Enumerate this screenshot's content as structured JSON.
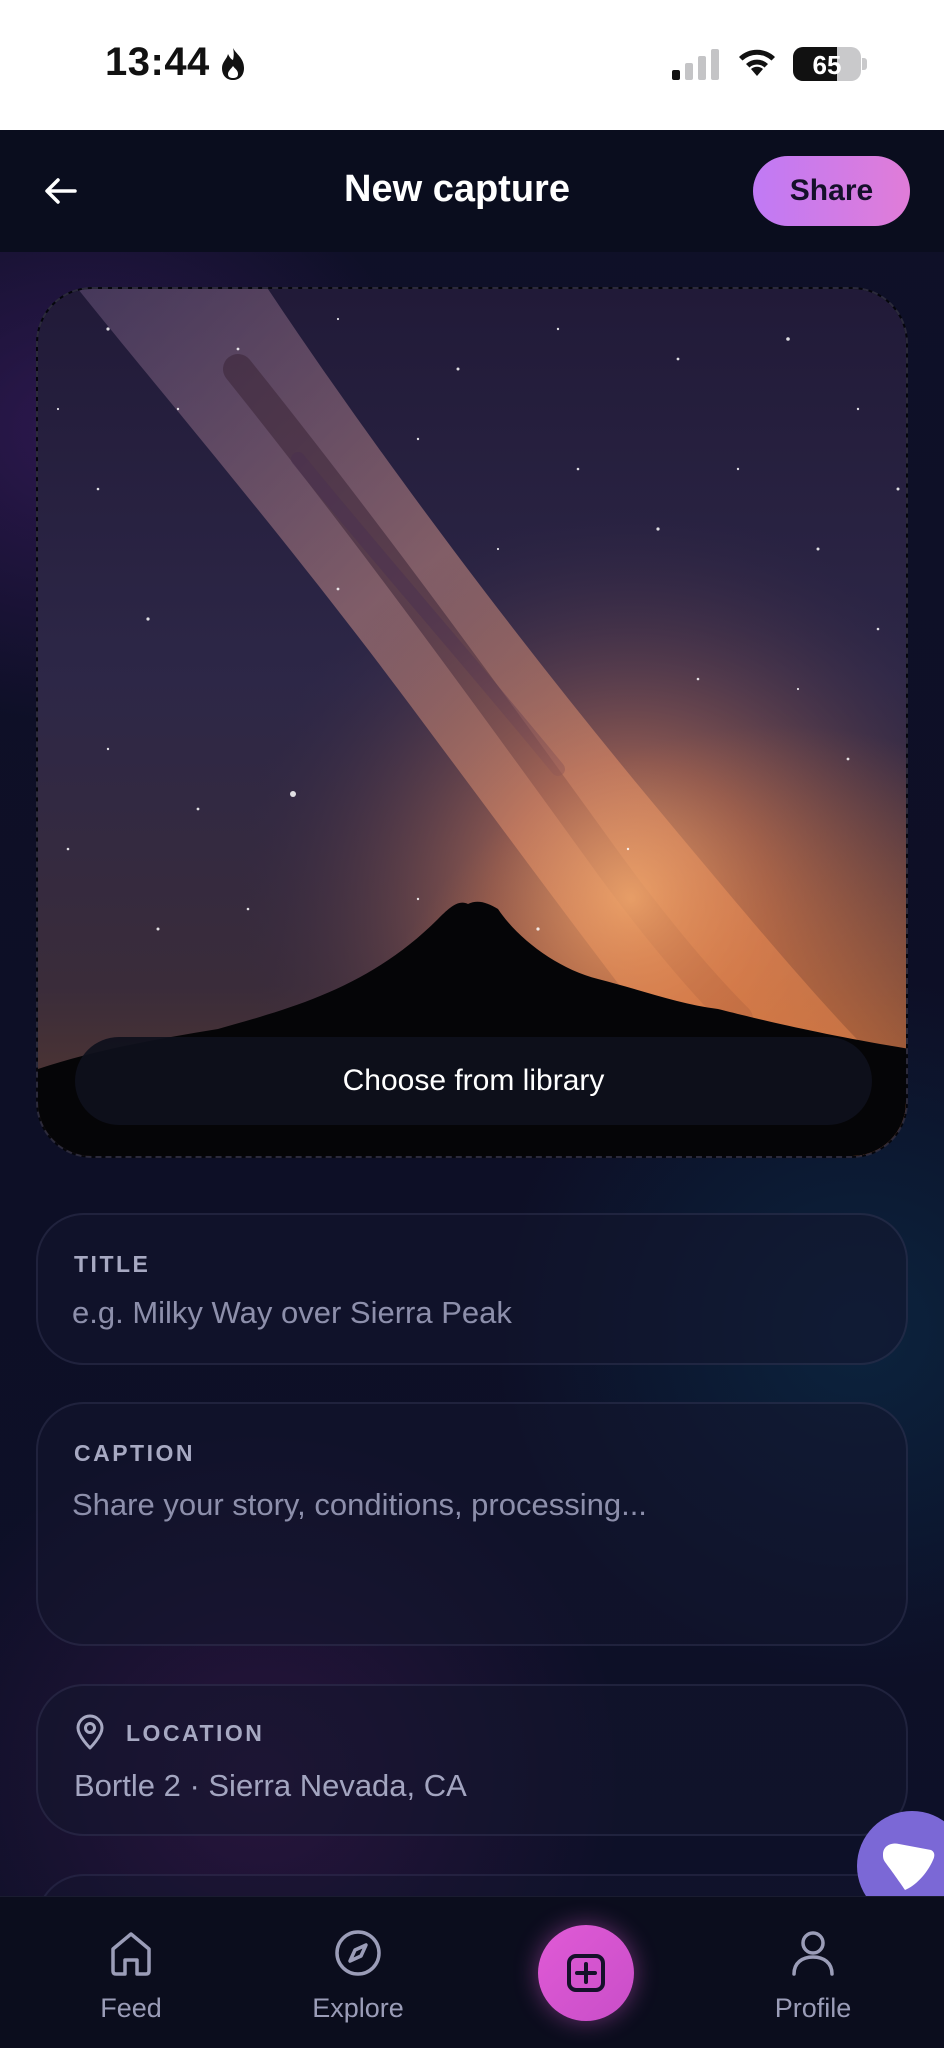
{
  "status_bar": {
    "time": "13:44",
    "battery": "65"
  },
  "header": {
    "title": "New capture",
    "share_label": "Share"
  },
  "image_picker": {
    "button_label": "Choose from library"
  },
  "fields": {
    "title": {
      "label": "TITLE",
      "placeholder": "e.g. Milky Way over Sierra Peak"
    },
    "caption": {
      "label": "CAPTION",
      "placeholder": "Share your story, conditions, processing..."
    },
    "location": {
      "label": "LOCATION",
      "value": "Bortle 2 · Sierra Nevada, CA"
    }
  },
  "nav": {
    "items": [
      {
        "label": "Feed",
        "icon": "home-icon"
      },
      {
        "label": "Explore",
        "icon": "compass-icon"
      },
      {
        "label": "",
        "icon": "plus-square-icon"
      },
      {
        "label": "Profile",
        "icon": "user-icon"
      }
    ]
  }
}
